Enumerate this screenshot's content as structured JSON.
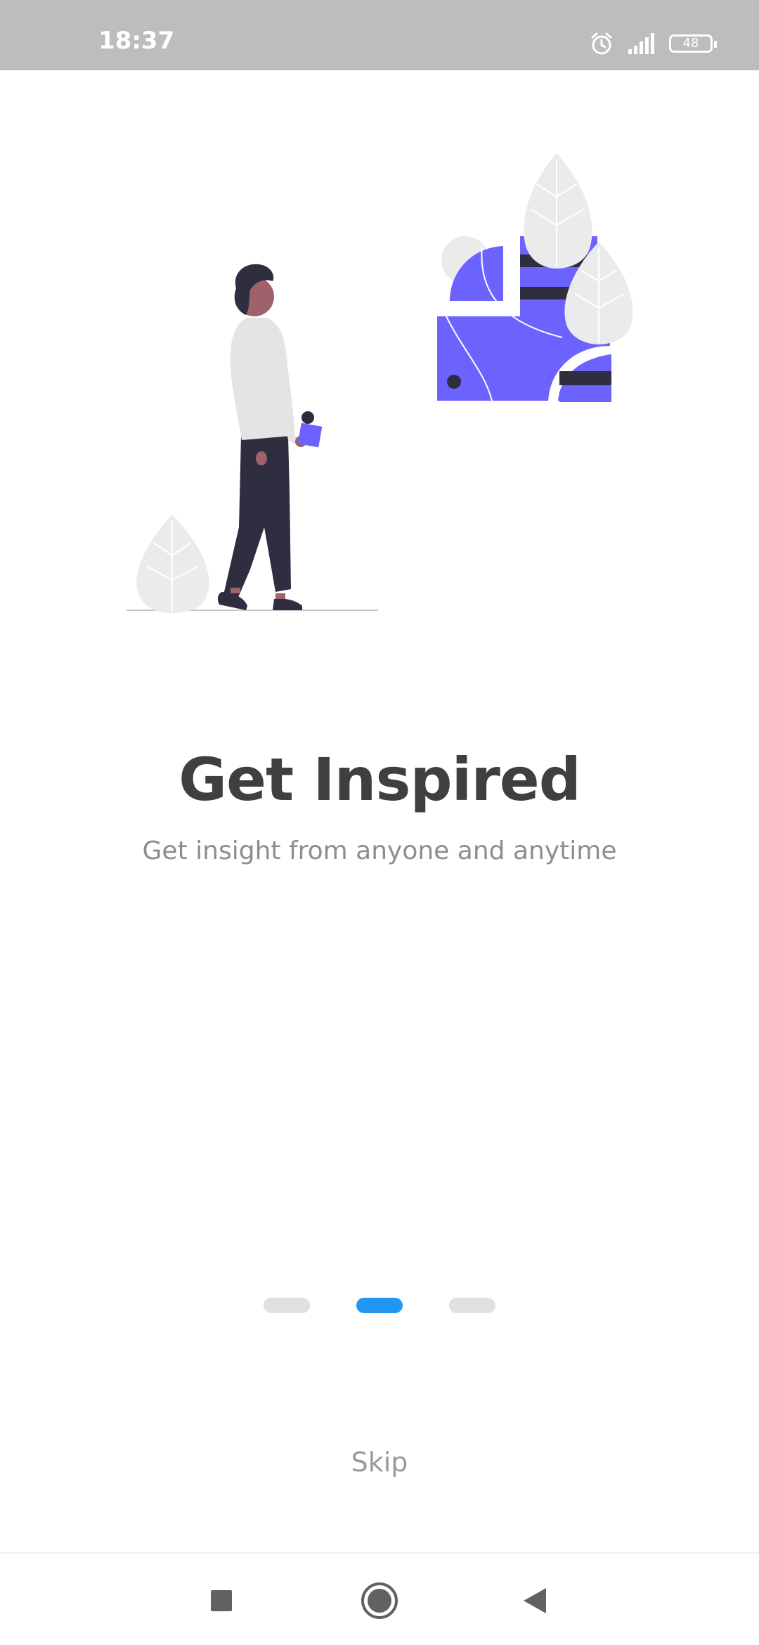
{
  "status_bar": {
    "time": "18:37",
    "battery_level": "48",
    "icons": [
      "alarm-icon",
      "signal-icon",
      "battery-icon"
    ]
  },
  "onboarding": {
    "title": "Get Inspired",
    "subtitle": "Get insight from anyone and anytime",
    "pager": {
      "total": 3,
      "active_index": 1
    },
    "skip_label": "Skip"
  },
  "nav_bar": {
    "buttons": [
      "recents-square-icon",
      "home-circle-icon",
      "back-triangle-icon"
    ]
  },
  "colors": {
    "status_bar_bg": "#bdbdbd",
    "title": "#3f3f3f",
    "subtitle": "#8d8d8d",
    "accent": "#2196f3",
    "illustration_purple": "#6c63ff",
    "illustration_dark": "#2f2e41",
    "illustration_leaf": "#ebebeb"
  }
}
